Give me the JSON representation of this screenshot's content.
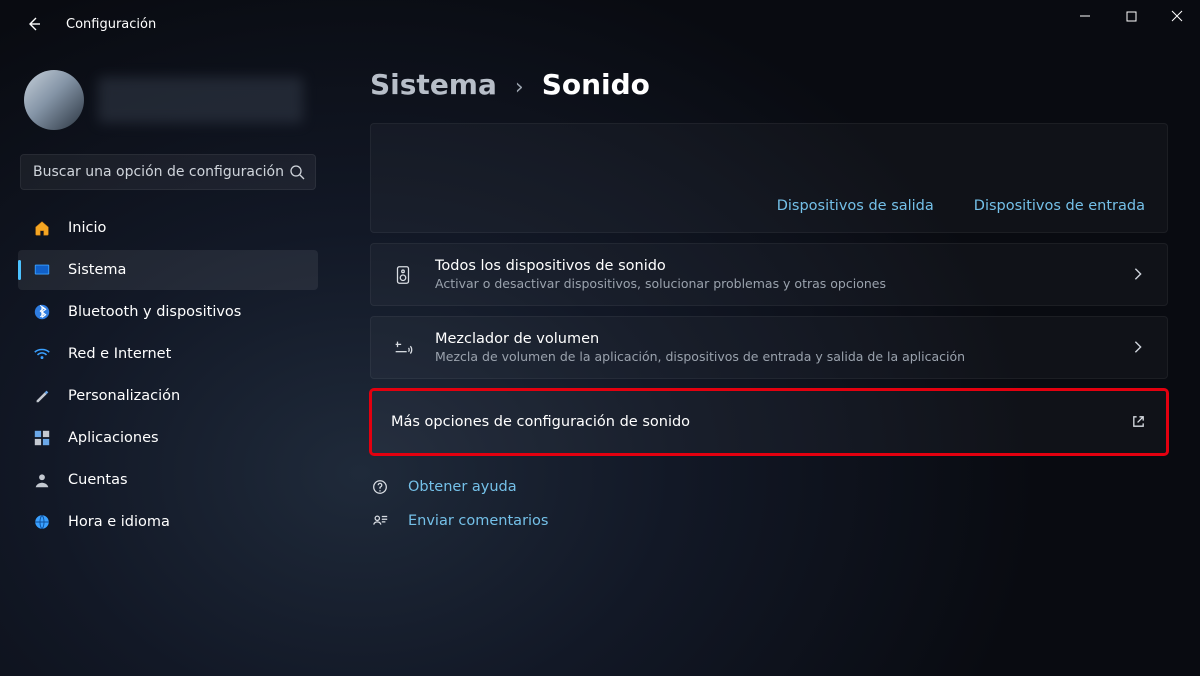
{
  "window": {
    "title": "Configuración"
  },
  "search": {
    "placeholder": "Buscar una opción de configuración"
  },
  "sidebar": {
    "items": [
      {
        "icon": "home",
        "label": "Inicio"
      },
      {
        "icon": "system",
        "label": "Sistema",
        "active": true
      },
      {
        "icon": "bluetooth",
        "label": "Bluetooth y dispositivos"
      },
      {
        "icon": "wifi",
        "label": "Red e Internet"
      },
      {
        "icon": "brush",
        "label": "Personalización"
      },
      {
        "icon": "apps",
        "label": "Aplicaciones"
      },
      {
        "icon": "account",
        "label": "Cuentas"
      },
      {
        "icon": "globe",
        "label": "Hora e idioma"
      }
    ]
  },
  "breadcrumb": {
    "parent": "Sistema",
    "current": "Sonido"
  },
  "top_links": {
    "output": "Dispositivos de salida",
    "input": "Dispositivos de entrada"
  },
  "rows": {
    "all_devices": {
      "title": "Todos los dispositivos de sonido",
      "sub": "Activar o desactivar dispositivos, solucionar problemas y otras opciones"
    },
    "mixer": {
      "title": "Mezclador de volumen",
      "sub": "Mezcla de volumen de la aplicación, dispositivos de entrada y salida de la aplicación"
    },
    "more": {
      "title": "Más opciones de configuración de sonido"
    }
  },
  "footer": {
    "help": "Obtener ayuda",
    "feedback": "Enviar comentarios"
  }
}
